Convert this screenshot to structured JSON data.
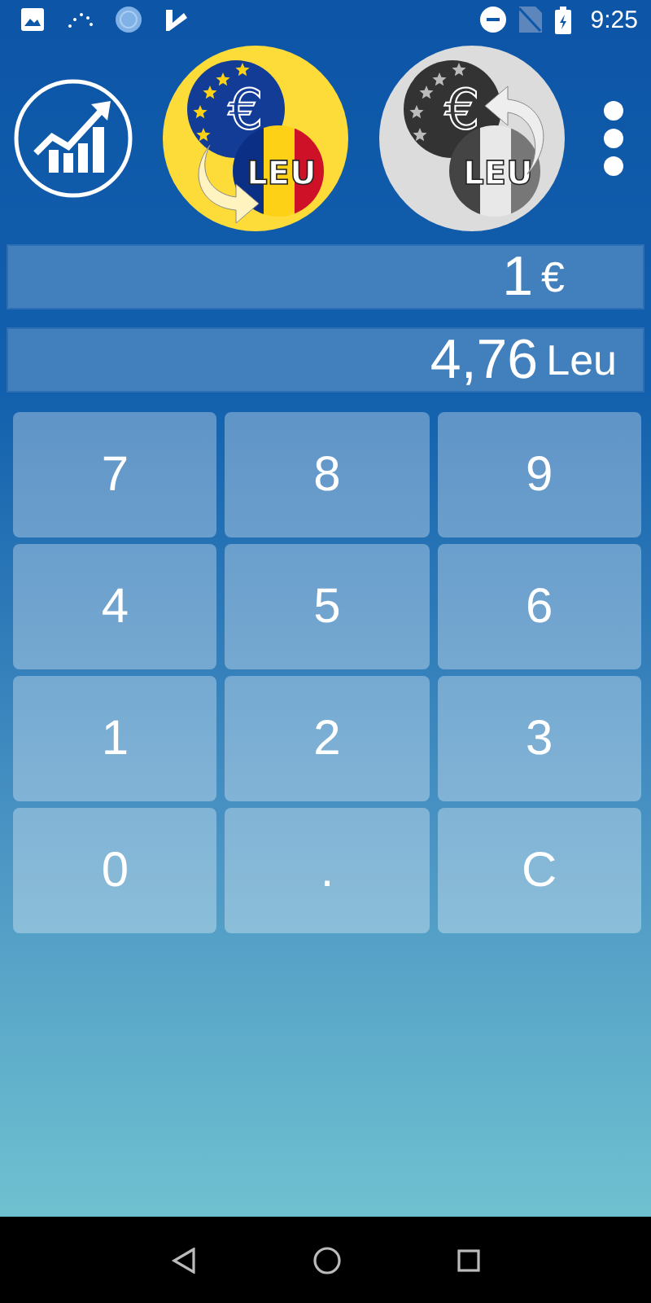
{
  "status_bar": {
    "time": "9:25"
  },
  "coins": [
    {
      "kind": "eur-to-leu",
      "selected": true,
      "euro_sign": "€",
      "leu_label": "LEU"
    },
    {
      "kind": "leu-to-eur",
      "selected": false,
      "euro_sign": "€",
      "leu_label": "LEU"
    }
  ],
  "amount": {
    "value": "1",
    "unit": "€"
  },
  "result": {
    "value": "4,76",
    "unit": "Leu"
  },
  "keys": [
    "7",
    "8",
    "9",
    "4",
    "5",
    "6",
    "1",
    "2",
    "3",
    "0",
    ".",
    "C"
  ]
}
